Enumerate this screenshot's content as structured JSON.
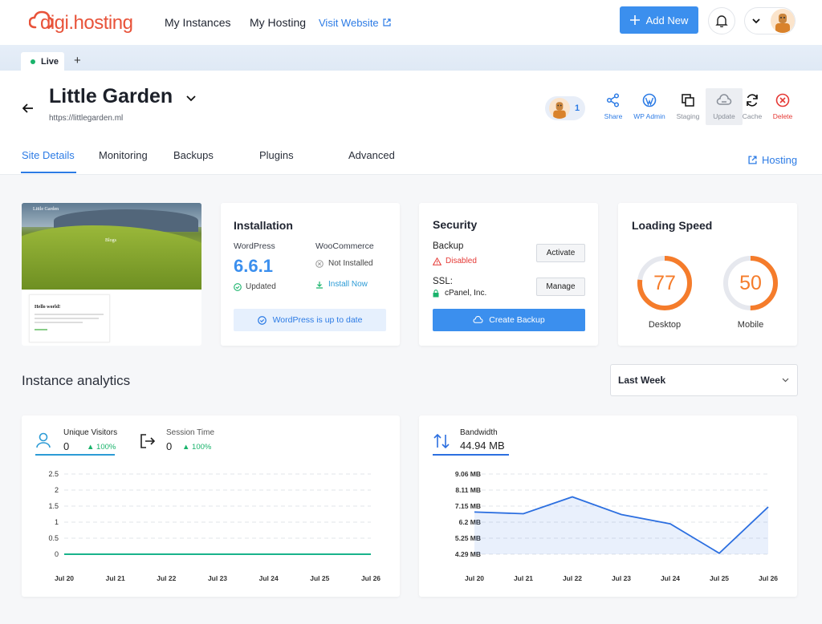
{
  "brand": {
    "name": "digi.hosting",
    "color": "#e8533a",
    "accent": "#3b8fee"
  },
  "nav": {
    "items": [
      "My Instances",
      "My Hosting"
    ],
    "visit_website": "Visit Website",
    "add_new": "Add New"
  },
  "tabs_bar": {
    "live_tab": "Live",
    "add_tab": "+"
  },
  "site": {
    "title": "Little Garden",
    "url": "https://littlegarden.ml",
    "members_count": "1"
  },
  "actions": [
    {
      "label": "Share",
      "icon": "share-icon"
    },
    {
      "label": "WP Admin",
      "icon": "wordpress-icon"
    },
    {
      "label": "Staging",
      "icon": "copy-icon"
    },
    {
      "label": "Update",
      "icon": "cloud-icon"
    },
    {
      "label": "Cache",
      "icon": "refresh-icon"
    },
    {
      "label": "Delete",
      "icon": "close-circle-icon"
    }
  ],
  "page_tabs": [
    "Site Details",
    "Monitoring",
    "Backups",
    "Plugins",
    "Advanced"
  ],
  "hosting_link": "Hosting",
  "preview": {
    "site_name": "Little Garden",
    "hero_text": "Blogs",
    "post_title": "Hello world!"
  },
  "installation": {
    "title": "Installation",
    "wp_label": "WordPress",
    "wp_version": "6.6.1",
    "wp_status": "Updated",
    "woo_label": "WooCommerce",
    "woo_status": "Not Installed",
    "woo_action": "Install Now",
    "uptodate": "WordPress is up to date"
  },
  "security": {
    "title": "Security",
    "backup_label": "Backup",
    "backup_status": "Disabled",
    "activate": "Activate",
    "ssl_label": "SSL:",
    "ssl_value": "cPanel, Inc.",
    "manage": "Manage",
    "create_backup": "Create Backup"
  },
  "speed": {
    "title": "Loading Speed",
    "desktop": {
      "value": 77,
      "label": "Desktop"
    },
    "mobile": {
      "value": 50,
      "label": "Mobile"
    },
    "color": "#f57c2b"
  },
  "analytics": {
    "title": "Instance analytics",
    "range": "Last Week"
  },
  "visitors": {
    "unique_label": "Unique Visitors",
    "unique_value": "0",
    "unique_change": "100%",
    "session_label": "Session Time",
    "session_value": "0",
    "session_change": "100%"
  },
  "bandwidth": {
    "label": "Bandwidth",
    "value": "44.94 MB"
  },
  "chart_data": [
    {
      "type": "line",
      "x": [
        "Jul 20",
        "Jul 21",
        "Jul 22",
        "Jul 23",
        "Jul 24",
        "Jul 25",
        "Jul 26"
      ],
      "yticks": [
        "0",
        "0.5",
        "1",
        "1.5",
        "2",
        "2.5"
      ],
      "ylim": [
        0,
        2.5
      ],
      "series": [
        {
          "values": [
            0,
            0,
            0,
            0,
            0,
            0,
            0
          ],
          "color": "#19b38b"
        }
      ],
      "grid": true
    },
    {
      "type": "area",
      "x": [
        "Jul 20",
        "Jul 21",
        "Jul 22",
        "Jul 23",
        "Jul 24",
        "Jul 25",
        "Jul 26"
      ],
      "yticks": [
        "4.29 MB",
        "5.25 MB",
        "6.2 MB",
        "7.15 MB",
        "8.11 MB",
        "9.06 MB"
      ],
      "ylim": [
        4.29,
        9.06
      ],
      "series": [
        {
          "values": [
            6.8,
            6.7,
            7.7,
            6.65,
            6.1,
            4.35,
            7.1
          ],
          "color": "#2c6fe0"
        }
      ],
      "grid": true
    }
  ]
}
